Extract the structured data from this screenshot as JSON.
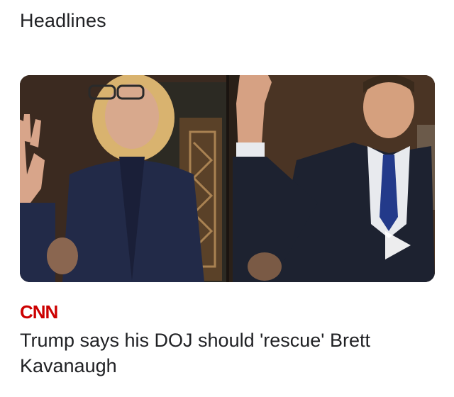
{
  "section": {
    "title": "Headlines"
  },
  "article": {
    "source": "CNN",
    "headline": "Trump says his DOJ should 'rescue' Brett Kavanaugh",
    "media": {
      "type": "video",
      "play_icon": "play-icon"
    }
  },
  "colors": {
    "source_logo": "#cc0000",
    "text": "#202124"
  }
}
